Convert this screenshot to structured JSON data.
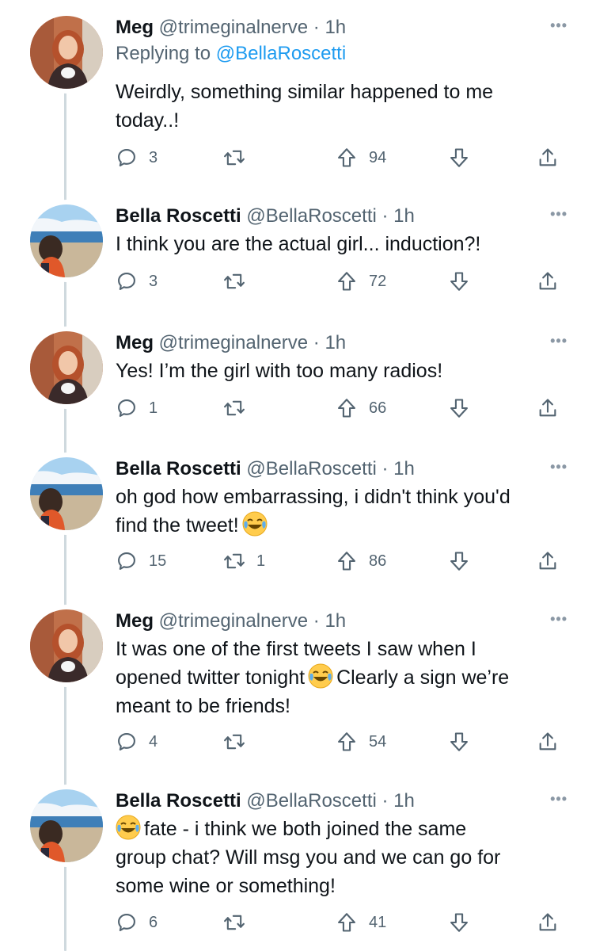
{
  "more_glyph": "•••",
  "tweets": [
    {
      "name": "Meg",
      "handle": "@trimeginalnerve",
      "time": "· 1h",
      "author": "meg",
      "replying_label": "Replying to ",
      "replying_handle": "@BellaRoscetti",
      "lines": [
        "Weirdly, something similar happened to me",
        "today..!"
      ],
      "replies": "3",
      "retweets": "",
      "upvotes": "94"
    },
    {
      "name": "Bella Roscetti",
      "handle": "@BellaRoscetti",
      "time": "· 1h",
      "author": "bella",
      "lines": [
        "I think you are the actual girl... induction?!"
      ],
      "replies": "3",
      "retweets": "",
      "upvotes": "72"
    },
    {
      "name": "Meg",
      "handle": "@trimeginalnerve",
      "time": "· 1h",
      "author": "meg",
      "lines": [
        "Yes! I’m the girl with too many radios!"
      ],
      "replies": "1",
      "retweets": "",
      "upvotes": "66"
    },
    {
      "name": "Bella Roscetti",
      "handle": "@BellaRoscetti",
      "time": "· 1h",
      "author": "bella",
      "lines": [
        "oh god how embarrassing, i didn't think you'd",
        "find the tweet!"
      ],
      "replies": "15",
      "retweets": "1",
      "upvotes": "86"
    },
    {
      "name": "Meg",
      "handle": "@trimeginalnerve",
      "time": "· 1h",
      "author": "meg",
      "lines": [
        "It was one of the first tweets I saw when I",
        "opened twitter tonight",
        "Clearly a sign we’re",
        "meant to be friends!"
      ],
      "replies": "4",
      "retweets": "",
      "upvotes": "54"
    },
    {
      "name": "Bella Roscetti",
      "handle": "@BellaRoscetti",
      "time": "· 1h",
      "author": "bella",
      "lines": [
        "fate -  i think we both joined the same",
        "group chat? Will msg you and we can go for",
        "some wine or something!"
      ],
      "replies": "6",
      "retweets": "",
      "upvotes": "41"
    }
  ]
}
